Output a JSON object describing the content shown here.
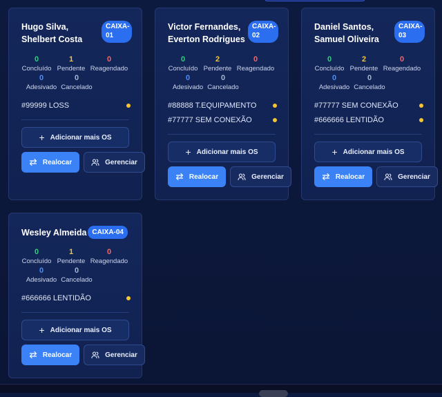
{
  "stat_labels": {
    "concluido": "Concluído",
    "pendente": "Pendente",
    "reagendado": "Reagendado",
    "adesivado": "Adesivado",
    "cancelado": "Cancelado"
  },
  "buttons": {
    "add_label": "Adicionar mais OS",
    "realocar_label": "Realocar",
    "gerenciar_label": "Gerenciar"
  },
  "cards": [
    {
      "names": "Hugo Silva, Shelbert Costa",
      "badge": "CAIXA-01",
      "stats": {
        "concluido": "0",
        "pendente": "1",
        "reagendado": "0",
        "adesivado": "0",
        "cancelado": "0"
      },
      "os": [
        {
          "text": "#99999 LOSS"
        }
      ]
    },
    {
      "names": "Victor Fernandes, Everton Rodrigues",
      "badge": "CAIXA-02",
      "stats": {
        "concluido": "0",
        "pendente": "2",
        "reagendado": "0",
        "adesivado": "0",
        "cancelado": "0"
      },
      "os": [
        {
          "text": "#88888 T.EQUIPAMENTO"
        },
        {
          "text": "#77777 SEM CONEXÃO"
        }
      ]
    },
    {
      "names": "Daniel Santos, Samuel Oliveira",
      "badge": "CAIXA-03",
      "stats": {
        "concluido": "0",
        "pendente": "2",
        "reagendado": "0",
        "adesivado": "0",
        "cancelado": "0"
      },
      "os": [
        {
          "text": "#77777 SEM CONEXÃO"
        },
        {
          "text": "#666666 LENTIDÃO"
        }
      ]
    },
    {
      "names": "Wesley Almeida",
      "badge": "CAIXA-04",
      "stats": {
        "concluido": "0",
        "pendente": "1",
        "reagendado": "0",
        "adesivado": "0",
        "cancelado": "0"
      },
      "os": [
        {
          "text": "#666666 LENTIDÃO"
        }
      ]
    }
  ],
  "colors": {
    "concluido": "#2fd07a",
    "pendente": "#f4c542",
    "reagendado": "#f0686c",
    "adesivado": "#4f8df5",
    "cancelado": "#aab5d3",
    "accent": "#3b82f6",
    "status_dot": "#f6c532"
  },
  "icons": {
    "add": "plus-icon",
    "realocar": "swap-arrows-icon",
    "gerenciar": "users-icon"
  }
}
